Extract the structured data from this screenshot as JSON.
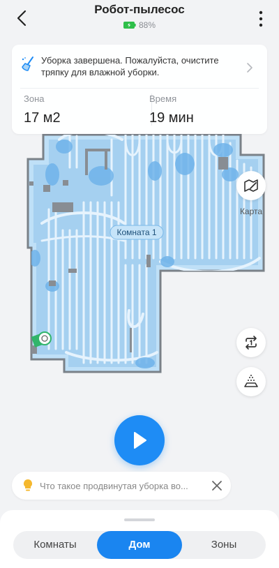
{
  "header": {
    "title": "Робот-пылесос",
    "battery": "88%"
  },
  "card": {
    "message": "Уборка завершена. Пожалуйста, очистите тряпку для влажной уборки.",
    "area_label": "Зона",
    "area_value": "17 м2",
    "time_label": "Время",
    "time_value": "19 мин"
  },
  "map": {
    "room_label": "Комната 1",
    "map_button_label": "Карта",
    "colors": {
      "floor": "#a5d0f0",
      "path": "#e3f2fc",
      "wall": "#7a8188",
      "obstacle": "#888d93"
    }
  },
  "tip": {
    "text": "Что такое продвинутая уборка во..."
  },
  "tabs": {
    "rooms": "Комнаты",
    "home": "Дом",
    "zones": "Зоны"
  },
  "colors": {
    "accent": "#1e8cf5",
    "battery": "#2fbf4a"
  }
}
